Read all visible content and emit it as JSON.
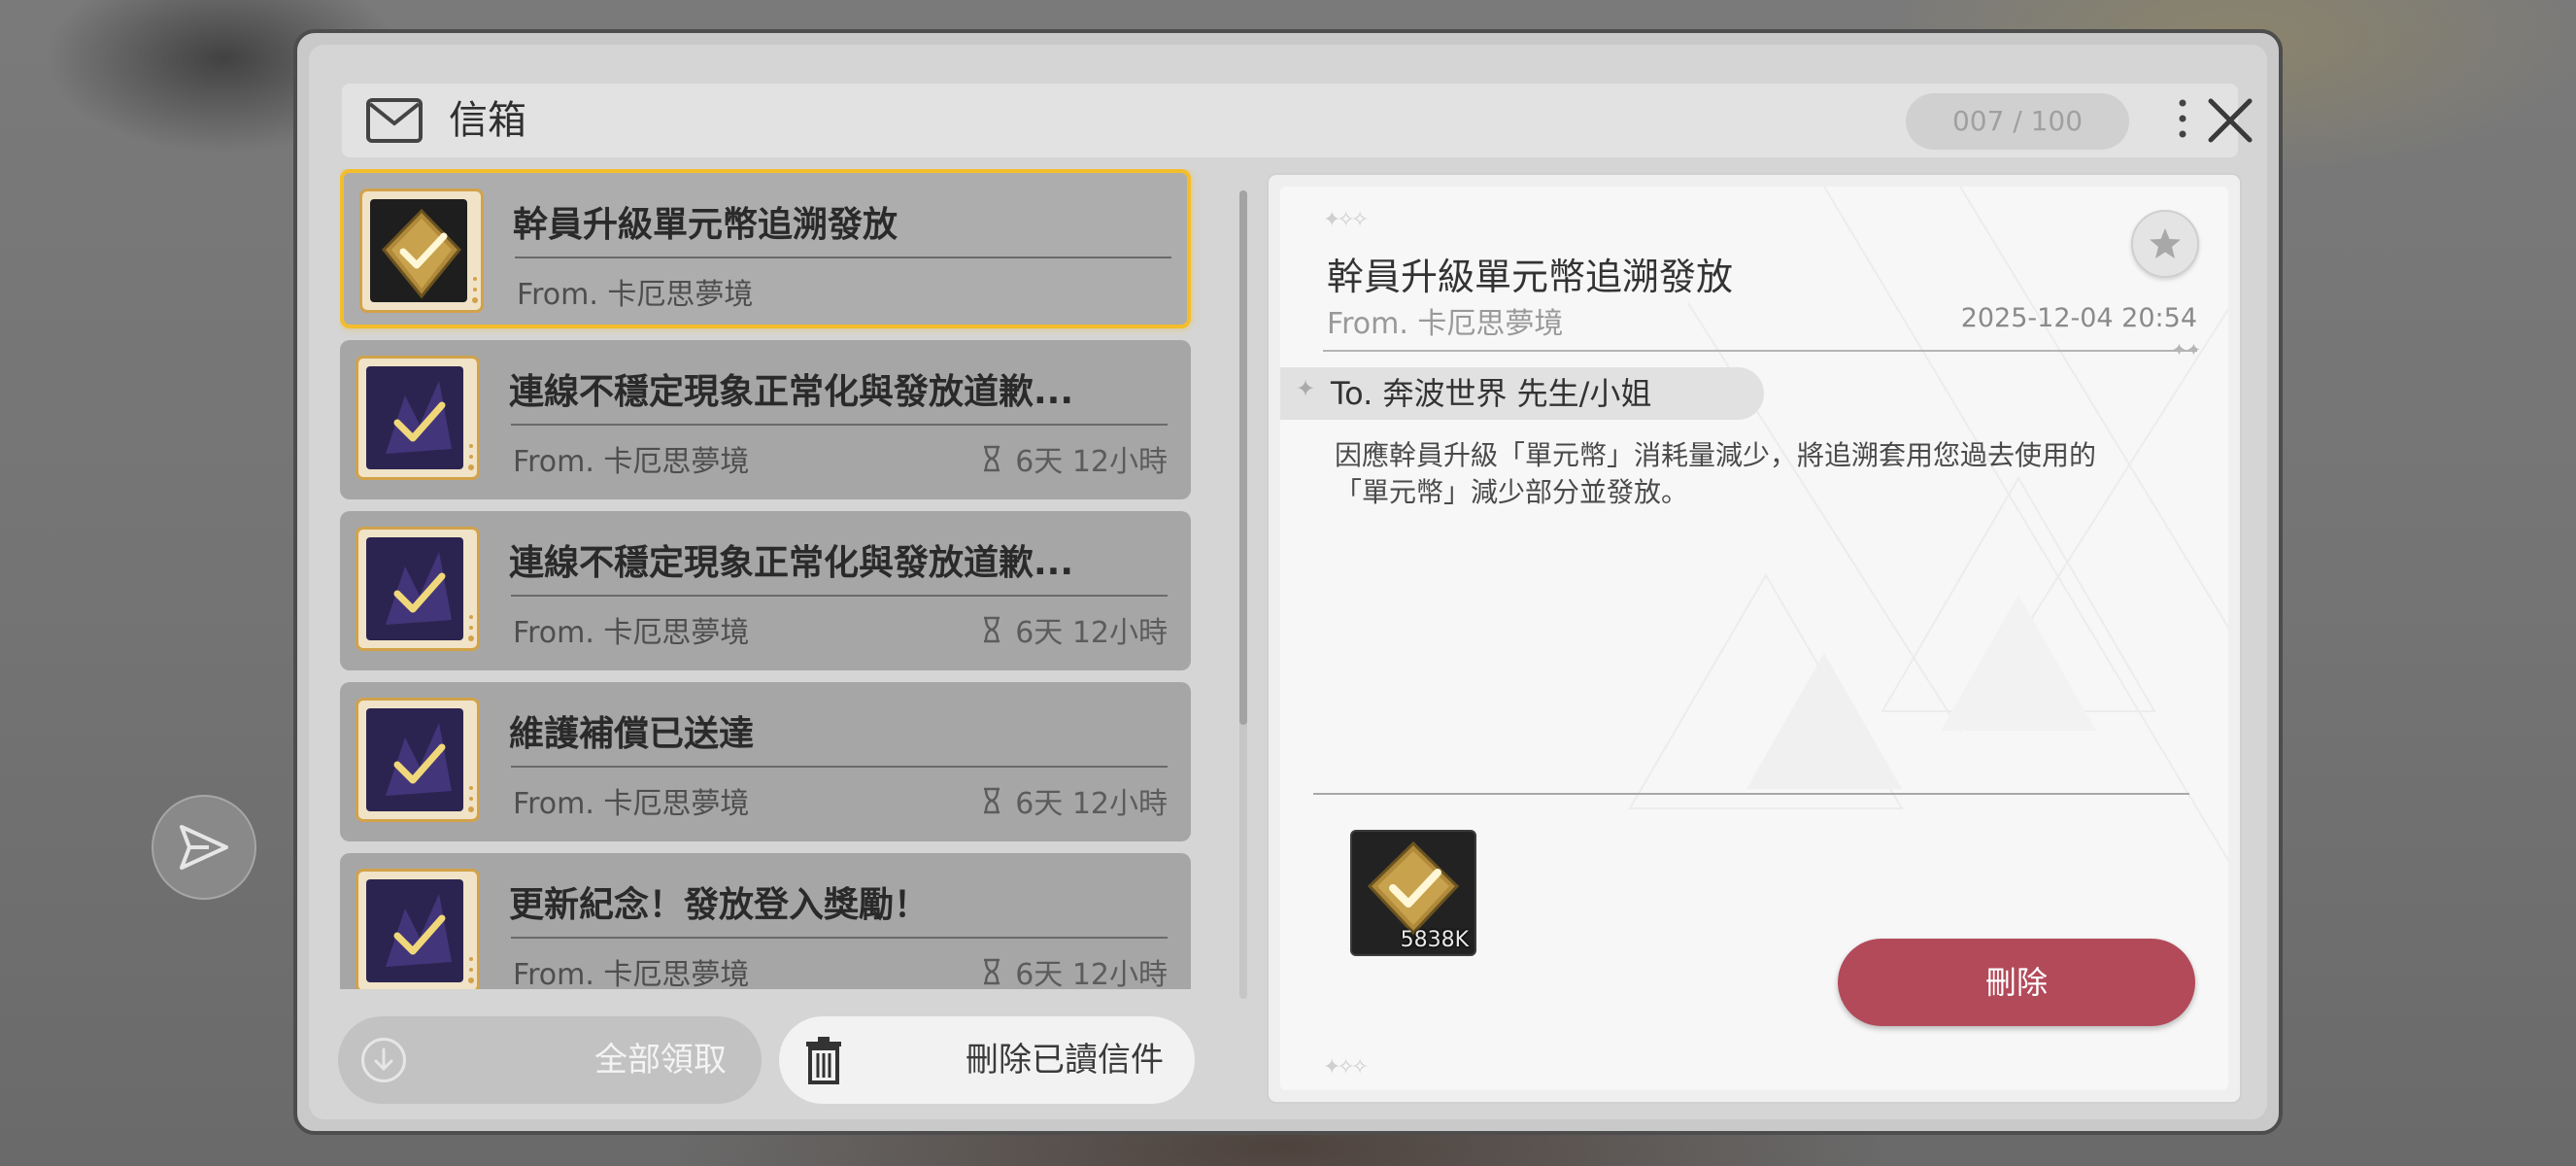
{
  "mailbox": {
    "title": "信箱",
    "counter": "007 / 100",
    "icons": {
      "mail": "envelope-icon",
      "more": "more-vertical-icon",
      "close": "close-icon",
      "share": "share-icon"
    }
  },
  "mail_list": [
    {
      "title": "幹員升級單元幣追溯發放",
      "from": "From. 卡厄思夢境",
      "time_left": "",
      "selected": true,
      "icon": "gold-check-item-icon"
    },
    {
      "title": "連線不穩定現象正常化與發放道歉...",
      "from": "From. 卡厄思夢境",
      "time_left": "6天 12小時",
      "selected": false,
      "icon": "purple-check-item-icon"
    },
    {
      "title": "連線不穩定現象正常化與發放道歉...",
      "from": "From. 卡厄思夢境",
      "time_left": "6天 12小時",
      "selected": false,
      "icon": "purple-check-item-icon"
    },
    {
      "title": "維護補償已送達",
      "from": "From. 卡厄思夢境",
      "time_left": "6天 12小時",
      "selected": false,
      "icon": "purple-check-item-icon"
    },
    {
      "title": "更新紀念！發放登入獎勵！",
      "from": "From. 卡厄思夢境",
      "time_left": "6天 12小時",
      "selected": false,
      "icon": "purple-check-item-icon"
    }
  ],
  "actions": {
    "claim_all": "全部領取",
    "delete_read": "刪除已讀信件"
  },
  "detail": {
    "title": "幹員升級單元幣追溯發放",
    "from": "From. 卡厄思夢境",
    "date": "2025-12-04 20:54",
    "to": "To. 奔波世界 先生/小姐",
    "body": [
      "因應幹員升級「單元幣」消耗量減少，將追溯套用您過去使用的",
      "「單元幣」減少部分並發放。"
    ],
    "attachment": {
      "icon": "gold-check-item-icon",
      "quantity": "5838K"
    },
    "delete_button": "刪除"
  },
  "colors": {
    "selected_border": "#f4bd2b",
    "delete_button": "#b34a5a",
    "item_card": "#a6a6a6"
  }
}
